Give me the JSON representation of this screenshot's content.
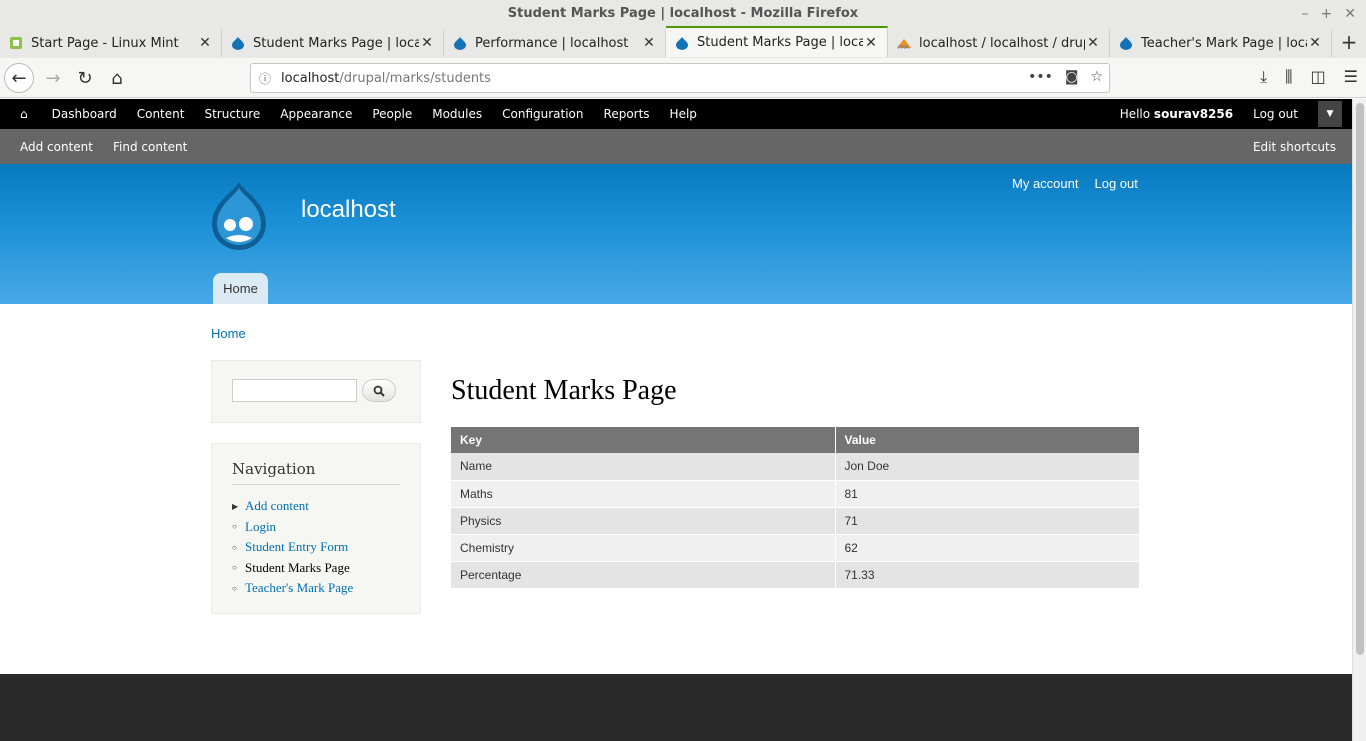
{
  "window": {
    "title": "Student Marks Page | localhost - Mozilla Firefox"
  },
  "tabs": [
    {
      "label": "Start Page - Linux Mint",
      "icon": "linux-mint-icon",
      "active": false
    },
    {
      "label": "Student Marks Page | localho",
      "icon": "drupal-icon",
      "active": false
    },
    {
      "label": "Performance | localhost",
      "icon": "drupal-icon",
      "active": false
    },
    {
      "label": "Student Marks Page | localho",
      "icon": "drupal-icon",
      "active": true
    },
    {
      "label": "localhost / localhost / drupal",
      "icon": "phpmyadmin-icon",
      "active": false
    },
    {
      "label": "Teacher's Mark Page | localh",
      "icon": "drupal-icon",
      "active": false
    }
  ],
  "url": {
    "domain": "localhost",
    "path": "/drupal/marks/students"
  },
  "admin_toolbar": {
    "items": [
      "Dashboard",
      "Content",
      "Structure",
      "Appearance",
      "People",
      "Modules",
      "Configuration",
      "Reports",
      "Help"
    ],
    "hello": "Hello ",
    "user": "sourav8256",
    "logout": "Log out"
  },
  "shortcuts": {
    "add_content": "Add content",
    "find_content": "Find content",
    "edit": "Edit shortcuts"
  },
  "header": {
    "site_name": "localhost",
    "my_account": "My account",
    "log_out": "Log out",
    "home_tab": "Home"
  },
  "breadcrumb": "Home",
  "sidebar": {
    "nav_title": "Navigation",
    "items": [
      {
        "label": "Add content",
        "bullet": "▶",
        "active": false
      },
      {
        "label": "Login",
        "bullet": "○",
        "active": false
      },
      {
        "label": "Student Entry Form",
        "bullet": "○",
        "active": false
      },
      {
        "label": "Student Marks Page",
        "bullet": "○",
        "active": true
      },
      {
        "label": "Teacher's Mark Page",
        "bullet": "○",
        "active": false
      }
    ]
  },
  "main": {
    "title": "Student Marks Page",
    "table": {
      "headers": [
        "Key",
        "Value"
      ],
      "rows": [
        [
          "Name",
          "Jon Doe"
        ],
        [
          "Maths",
          "81"
        ],
        [
          "Physics",
          "71"
        ],
        [
          "Chemistry",
          "62"
        ],
        [
          "Percentage",
          "71.33"
        ]
      ]
    }
  },
  "colors": {
    "accent": "#0071b3",
    "header_top": "#0779bf",
    "admin_bar": "#000000"
  }
}
